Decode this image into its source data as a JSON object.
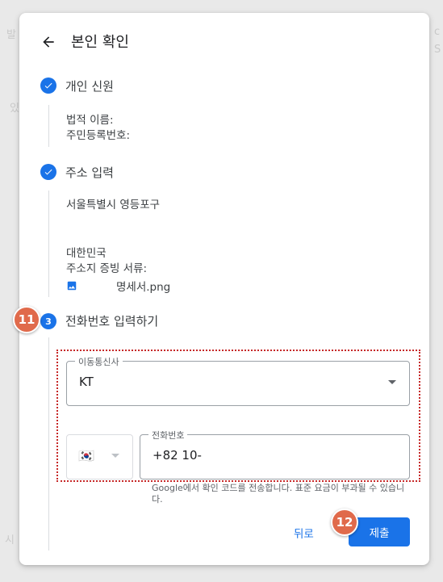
{
  "background": {
    "left_texts": [
      "발",
      "있",
      "시"
    ],
    "right_texts": [
      "c",
      "S"
    ]
  },
  "header": {
    "title": "본인 확인"
  },
  "steps": [
    {
      "title": "개인 신원",
      "fields": [
        "법적 이름:",
        "주민등록번호:"
      ]
    },
    {
      "title": "주소 입력",
      "fields": [
        "서울특별시 영등포구",
        "대한민국",
        "주소지 증빙 서류:"
      ],
      "file_name": "명세서.png"
    },
    {
      "number": "3",
      "title": "전화번호 입력하기"
    }
  ],
  "carrier_select": {
    "label": "이동통신사",
    "value": "KT"
  },
  "country_select": {
    "flag": "🇰🇷"
  },
  "phone_field": {
    "label": "전화번호",
    "value": "+82 10-"
  },
  "helper_text": "Google에서 확인 코드를 전송합니다. 표준 요금이 부과될 수 있습니다.",
  "buttons": {
    "back": "뒤로",
    "submit": "제출"
  },
  "annotations": {
    "badge_11": "11",
    "badge_12": "12"
  },
  "colors": {
    "accent": "#1a73e8",
    "annotation": "#e06a4b",
    "highlight_border": "#c62828"
  }
}
